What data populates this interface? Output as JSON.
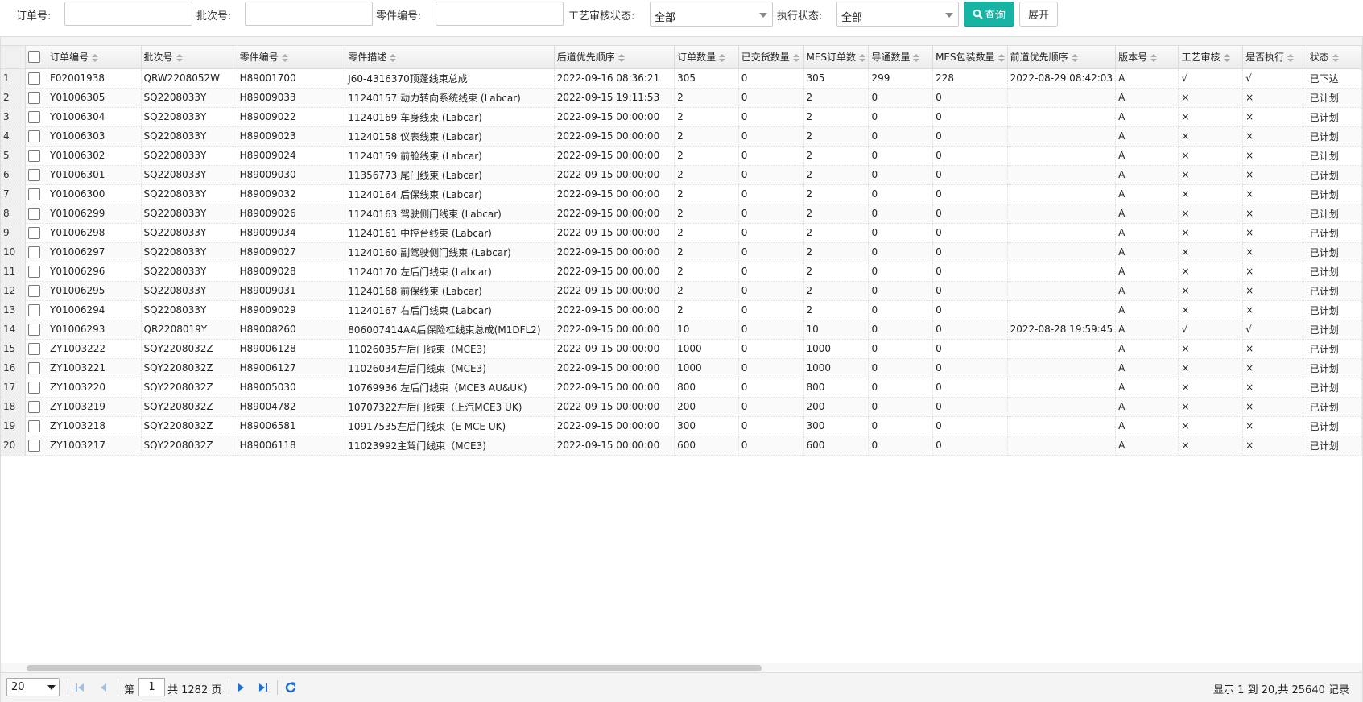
{
  "filters": {
    "order_no_label": "订单号:",
    "batch_no_label": "批次号:",
    "part_no_label": "零件编号:",
    "process_review_label": "工艺审核状态:",
    "process_review_value": "全部",
    "exec_status_label": "执行状态:",
    "exec_status_value": "全部",
    "query_button": "查询",
    "expand_button": "展开"
  },
  "table": {
    "columns": [
      "订单编号",
      "批次号",
      "零件编号",
      "零件描述",
      "后道优先顺序",
      "订单数量",
      "已交货数量",
      "MES订单数",
      "导通数量",
      "MES包装数量",
      "前道优先顺序",
      "版本号",
      "工艺审核",
      "是否执行",
      "状态"
    ],
    "rows": [
      [
        "1",
        "F02001938",
        "QRW2208052W",
        "H89001700",
        "J60-4316370顶蓬线束总成",
        "2022-09-16 08:36:21",
        "305",
        "0",
        "305",
        "299",
        "228",
        "2022-08-29 08:42:03",
        "A",
        "√",
        "√",
        "已下达"
      ],
      [
        "2",
        "Y01006305",
        "SQ2208033Y",
        "H89009033",
        "11240157 动力转向系统线束 (Labcar)",
        "2022-09-15 19:11:53",
        "2",
        "0",
        "2",
        "0",
        "0",
        "",
        "A",
        "×",
        "×",
        "已计划"
      ],
      [
        "3",
        "Y01006304",
        "SQ2208033Y",
        "H89009022",
        "11240169 车身线束 (Labcar)",
        "2022-09-15 00:00:00",
        "2",
        "0",
        "2",
        "0",
        "0",
        "",
        "A",
        "×",
        "×",
        "已计划"
      ],
      [
        "4",
        "Y01006303",
        "SQ2208033Y",
        "H89009023",
        "11240158 仪表线束 (Labcar)",
        "2022-09-15 00:00:00",
        "2",
        "0",
        "2",
        "0",
        "0",
        "",
        "A",
        "×",
        "×",
        "已计划"
      ],
      [
        "5",
        "Y01006302",
        "SQ2208033Y",
        "H89009024",
        "11240159 前舱线束 (Labcar)",
        "2022-09-15 00:00:00",
        "2",
        "0",
        "2",
        "0",
        "0",
        "",
        "A",
        "×",
        "×",
        "已计划"
      ],
      [
        "6",
        "Y01006301",
        "SQ2208033Y",
        "H89009030",
        "11356773 尾门线束 (Labcar)",
        "2022-09-15 00:00:00",
        "2",
        "0",
        "2",
        "0",
        "0",
        "",
        "A",
        "×",
        "×",
        "已计划"
      ],
      [
        "7",
        "Y01006300",
        "SQ2208033Y",
        "H89009032",
        "11240164 后保线束 (Labcar)",
        "2022-09-15 00:00:00",
        "2",
        "0",
        "2",
        "0",
        "0",
        "",
        "A",
        "×",
        "×",
        "已计划"
      ],
      [
        "8",
        "Y01006299",
        "SQ2208033Y",
        "H89009026",
        "11240163 驾驶侧门线束 (Labcar)",
        "2022-09-15 00:00:00",
        "2",
        "0",
        "2",
        "0",
        "0",
        "",
        "A",
        "×",
        "×",
        "已计划"
      ],
      [
        "9",
        "Y01006298",
        "SQ2208033Y",
        "H89009034",
        "11240161 中控台线束 (Labcar)",
        "2022-09-15 00:00:00",
        "2",
        "0",
        "2",
        "0",
        "0",
        "",
        "A",
        "×",
        "×",
        "已计划"
      ],
      [
        "10",
        "Y01006297",
        "SQ2208033Y",
        "H89009027",
        "11240160 副驾驶侧门线束 (Labcar)",
        "2022-09-15 00:00:00",
        "2",
        "0",
        "2",
        "0",
        "0",
        "",
        "A",
        "×",
        "×",
        "已计划"
      ],
      [
        "11",
        "Y01006296",
        "SQ2208033Y",
        "H89009028",
        "11240170 左后门线束 (Labcar)",
        "2022-09-15 00:00:00",
        "2",
        "0",
        "2",
        "0",
        "0",
        "",
        "A",
        "×",
        "×",
        "已计划"
      ],
      [
        "12",
        "Y01006295",
        "SQ2208033Y",
        "H89009031",
        "11240168 前保线束 (Labcar)",
        "2022-09-15 00:00:00",
        "2",
        "0",
        "2",
        "0",
        "0",
        "",
        "A",
        "×",
        "×",
        "已计划"
      ],
      [
        "13",
        "Y01006294",
        "SQ2208033Y",
        "H89009029",
        "11240167 右后门线束 (Labcar)",
        "2022-09-15 00:00:00",
        "2",
        "0",
        "2",
        "0",
        "0",
        "",
        "A",
        "×",
        "×",
        "已计划"
      ],
      [
        "14",
        "Y01006293",
        "QR2208019Y",
        "H89008260",
        "806007414AA后保险杠线束总成(M1DFL2)",
        "2022-09-15 00:00:00",
        "10",
        "0",
        "10",
        "0",
        "0",
        "2022-08-28 19:59:45",
        "A",
        "√",
        "√",
        "已计划"
      ],
      [
        "15",
        "ZY1003222",
        "SQY2208032Z",
        "H89006128",
        "11026035左后门线束（MCE3)",
        "2022-09-15 00:00:00",
        "1000",
        "0",
        "1000",
        "0",
        "0",
        "",
        "A",
        "×",
        "×",
        "已计划"
      ],
      [
        "16",
        "ZY1003221",
        "SQY2208032Z",
        "H89006127",
        "11026034左后门线束（MCE3)",
        "2022-09-15 00:00:00",
        "1000",
        "0",
        "1000",
        "0",
        "0",
        "",
        "A",
        "×",
        "×",
        "已计划"
      ],
      [
        "17",
        "ZY1003220",
        "SQY2208032Z",
        "H89005030",
        "10769936 左后门线束（MCE3 AU&UK)",
        "2022-09-15 00:00:00",
        "800",
        "0",
        "800",
        "0",
        "0",
        "",
        "A",
        "×",
        "×",
        "已计划"
      ],
      [
        "18",
        "ZY1003219",
        "SQY2208032Z",
        "H89004782",
        "10707322左后门线束（上汽MCE3 UK)",
        "2022-09-15 00:00:00",
        "200",
        "0",
        "200",
        "0",
        "0",
        "",
        "A",
        "×",
        "×",
        "已计划"
      ],
      [
        "19",
        "ZY1003218",
        "SQY2208032Z",
        "H89006581",
        "10917535左后门线束（E MCE UK)",
        "2022-09-15 00:00:00",
        "300",
        "0",
        "300",
        "0",
        "0",
        "",
        "A",
        "×",
        "×",
        "已计划"
      ],
      [
        "20",
        "ZY1003217",
        "SQY2208032Z",
        "H89006118",
        "11023992主驾门线束（MCE3)",
        "2022-09-15 00:00:00",
        "600",
        "0",
        "600",
        "0",
        "0",
        "",
        "A",
        "×",
        "×",
        "已计划"
      ]
    ]
  },
  "pager": {
    "page_size": "20",
    "page_prefix": "第",
    "page_value": "1",
    "page_total": "共 1282 页",
    "info": "显示 1 到 20,共 25640 记录"
  },
  "colors": {
    "accent": "#17b3a3",
    "pager_icon": "#1e6fd0"
  }
}
